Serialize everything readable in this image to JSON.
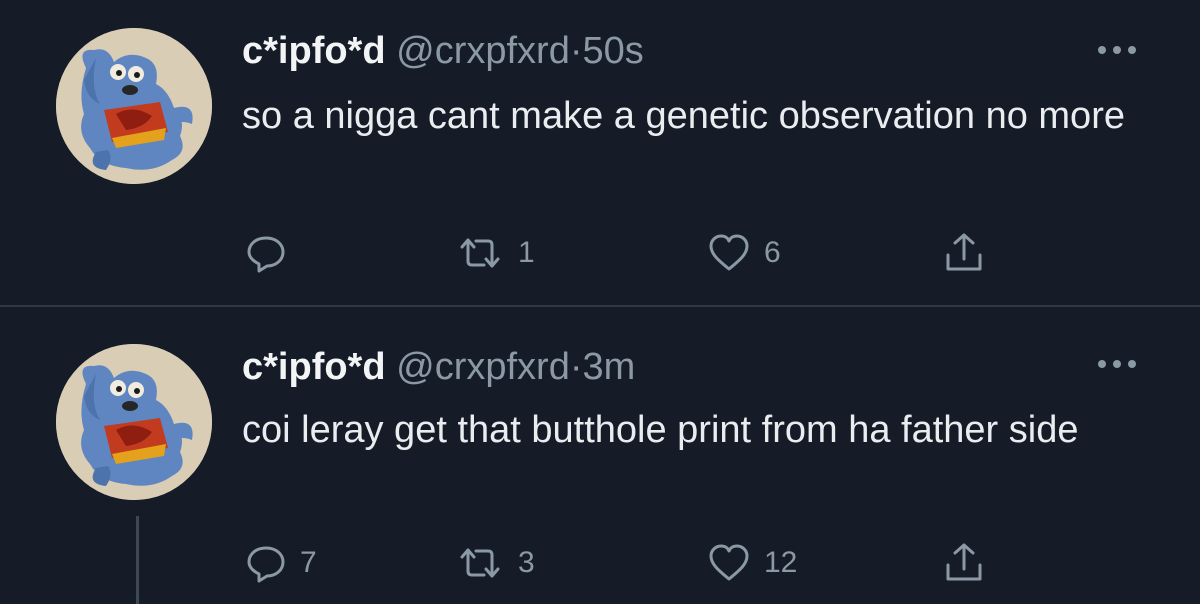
{
  "tweets": [
    {
      "display_name": "c*ipfo*d",
      "handle": "@crxpfxrd",
      "separator": "·",
      "time": "50s",
      "text": "so a nigga cant make a genetic observation no more",
      "replies": "",
      "retweets": "1",
      "likes": "6"
    },
    {
      "display_name": "c*ipfo*d",
      "handle": "@crxpfxrd",
      "separator": "·",
      "time": "3m",
      "text": "coi leray get that butthole print from ha father side",
      "replies": "7",
      "retweets": "3",
      "likes": "12"
    }
  ],
  "icons": {
    "reply": "reply-icon",
    "retweet": "retweet-icon",
    "like": "heart-icon",
    "share": "share-icon",
    "more": "more-options-icon"
  },
  "colors": {
    "background": "#151c27",
    "text": "#e9edf0",
    "muted": "#8b98a5",
    "divider": "#2e3945"
  }
}
